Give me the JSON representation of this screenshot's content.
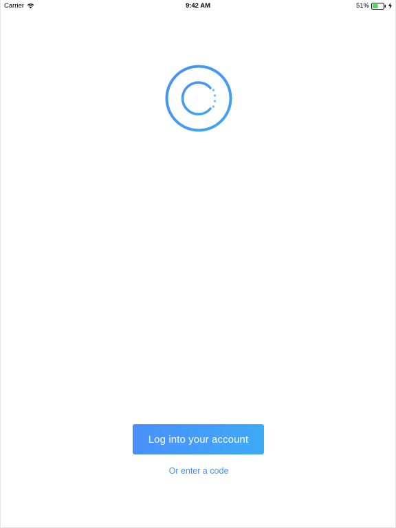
{
  "status_bar": {
    "carrier": "Carrier",
    "time": "9:42 AM",
    "battery_percent": "51%",
    "battery_level": 0.51,
    "wifi_icon": "wifi-icon",
    "battery_icon": "battery-icon",
    "charging_icon": "charging-bolt-icon"
  },
  "logo": {
    "icon": "app-logo-icon",
    "color_outer": "#4a90f2",
    "color_inner": "#4a90f2",
    "color_dots": "#7cc4f5"
  },
  "actions": {
    "login_label": "Log into your account",
    "code_link_label": "Or enter a code"
  },
  "colors": {
    "accent": "#4a90e2",
    "button_gradient_start": "#4a8ff8",
    "button_gradient_end": "#3daaf7",
    "background": "#ffffff"
  }
}
